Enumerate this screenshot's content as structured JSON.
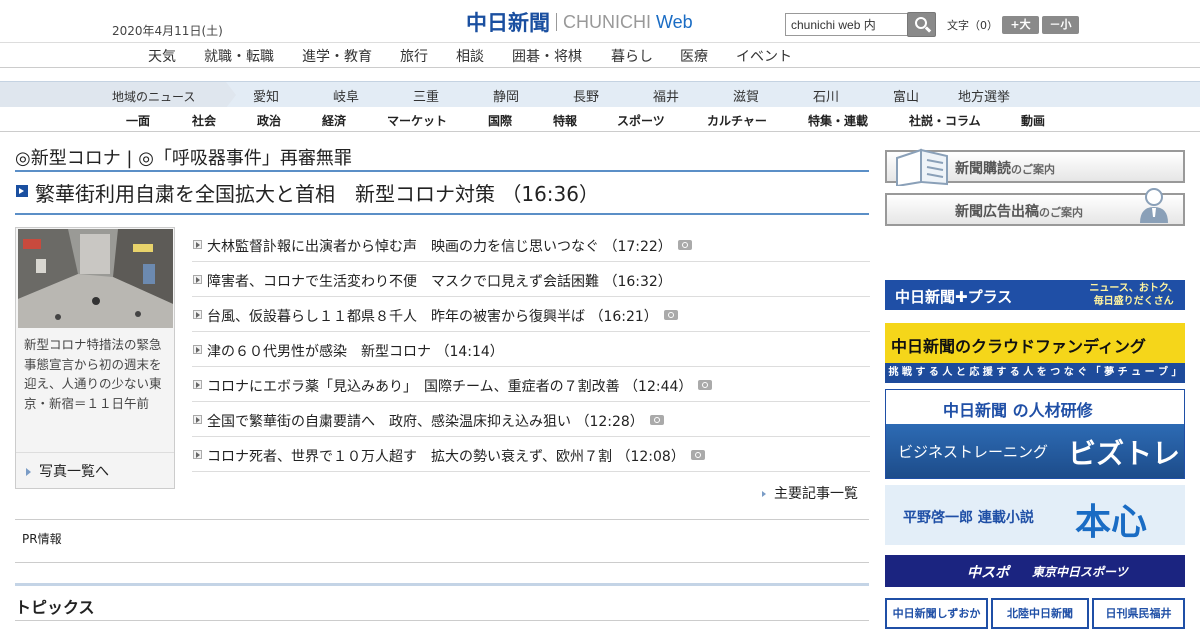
{
  "header": {
    "date": "2020年4月11日(土)",
    "logo_kanji": "中日新聞",
    "logo_latin": "CHUNICHI",
    "logo_web": "Web",
    "search_value": "chunichi web 内",
    "font_size_label": "文字（0）",
    "font_larger": "+大",
    "font_smaller": "－小"
  },
  "top_nav": [
    "天気",
    "就職・転職",
    "進学・教育",
    "旅行",
    "相談",
    "囲碁・将棋",
    "暮らし",
    "医療",
    "イベント"
  ],
  "regional_nav": {
    "label": "地域のニュース",
    "items": [
      "愛知",
      "岐阜",
      "三重",
      "静岡",
      "長野",
      "福井",
      "滋賀",
      "石川",
      "富山",
      "地方選挙"
    ]
  },
  "section_nav": [
    "一面",
    "社会",
    "政治",
    "経済",
    "マーケット",
    "国際",
    "特報",
    "スポーツ",
    "カルチャー",
    "特集・連載",
    "社説・コラム",
    "動画"
  ],
  "main": {
    "topic_header": "◎新型コロナ | ◎「呼吸器事件」再審無罪",
    "lead": "繁華街利用自粛を全国拡大と首相　新型コロナ対策 （16:36）",
    "photo_caption": "新型コロナ特措法の緊急事態宣言から初の週末を迎え、人通りの少ない東京・新宿＝１１日午前",
    "photo_link": "写真一覧へ",
    "articles": [
      {
        "title": "大林監督訃報に出演者から悼む声　映画の力を信じ思いつなぐ",
        "time": "（17:22）",
        "camera": true
      },
      {
        "title": "障害者、コロナで生活変わり不便　マスクで口見えず会話困難",
        "time": "（16:32）",
        "camera": false
      },
      {
        "title": "台風、仮設暮らし１１都県８千人　昨年の被害から復興半ば",
        "time": "（16:21）",
        "camera": true
      },
      {
        "title": "津の６０代男性が感染　新型コロナ",
        "time": "（14:14）",
        "camera": false
      },
      {
        "title": "コロナにエボラ薬「見込みあり」　国際チーム、重症者の７割改善",
        "time": "（12:44）",
        "camera": true
      },
      {
        "title": "全国で繁華街の自粛要請へ　政府、感染温床抑え込み狙い",
        "time": "（12:28）",
        "camera": true
      },
      {
        "title": "コロナ死者、世界で１０万人超す　拡大の勢い衰えず、欧州７割",
        "time": "（12:08）",
        "camera": true
      }
    ],
    "more_link": "主要記事一覧",
    "pr_label": "PR情報",
    "topics_label": "トピックス"
  },
  "sidebar": {
    "subscribe": {
      "main": "新聞購読",
      "sub": "のご案内"
    },
    "advertise": {
      "main": "新聞広告出稿",
      "sub": "のご案内"
    },
    "plus": {
      "a": "中日新聞✚プラス",
      "b1": "ニュース、おトク、",
      "b2": "毎日盛りだくさん"
    },
    "crowdfunding": {
      "a": "中日新聞のクラウドファンディング",
      "b": "挑 戦 す る 人 と 応 援 す る 人 を つ な ぐ 「 夢 チ ュ ー ブ 」"
    },
    "jinzai": {
      "a": "中日新聞 の人材研修",
      "b": "ビジネストレーニング",
      "c": "ビズトレ"
    },
    "novel": {
      "a": "平野啓一郎 連載小説",
      "b": "本心"
    },
    "chuspo": {
      "a": "中スポ",
      "b": "東京中日スポーツ"
    },
    "small_banners": [
      "中日新聞しずおか",
      "北陸中日新聞",
      "日刊県民福井"
    ]
  }
}
